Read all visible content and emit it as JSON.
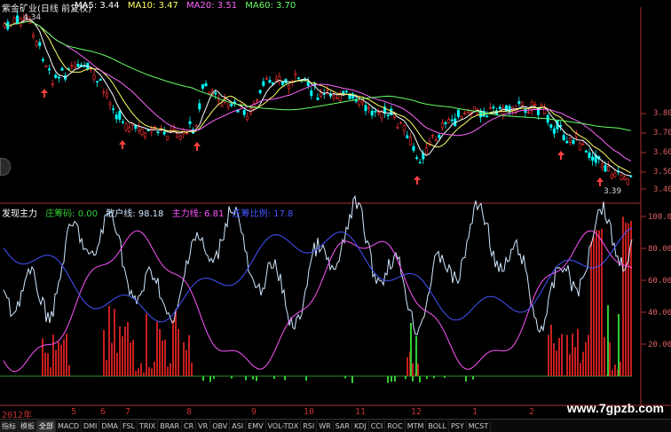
{
  "header": {
    "title": "紫金矿业(日线 前复权)",
    "ma": [
      {
        "label": "MA5: 3.44",
        "color": "#ffffff"
      },
      {
        "label": "MA10: 3.47",
        "color": "#ffff66"
      },
      {
        "label": "MA20: 3.51",
        "color": "#ff66ff"
      },
      {
        "label": "MA60: 3.70",
        "color": "#66ff66"
      }
    ],
    "high_mark": "4.34",
    "low_mark": "3.39"
  },
  "price_axis": [
    "3.80",
    "3.70",
    "3.60",
    "3.50",
    "3.40"
  ],
  "indicator": {
    "name": "发现主力",
    "fields": [
      {
        "label": "庄筹码: 0.00",
        "color": "#33cc33"
      },
      {
        "label": "散户线: 98.18",
        "color": "#cfe8ff"
      },
      {
        "label": "主力线: 6.81",
        "color": "#ff55ff"
      },
      {
        "label": "庄筹比例: 17.8",
        "color": "#4455ff"
      }
    ]
  },
  "indicator_axis": [
    "100.0",
    "80.00",
    "60.00",
    "40.00",
    "20.00"
  ],
  "time_axis": [
    "2012年",
    "5",
    "6",
    "7",
    "8",
    "9",
    "10",
    "11",
    "12",
    "1",
    "2"
  ],
  "tabs": [
    "指标",
    "模板",
    "全部",
    "MACD",
    "DMI",
    "DMA",
    "FSL",
    "TRIX",
    "BRAR",
    "CR",
    "VR",
    "OBV",
    "ASI",
    "EMV",
    "VOL-TDX",
    "RSI",
    "WR",
    "SAR",
    "KDJ",
    "CCI",
    "ROC",
    "MTM",
    "BOLL",
    "PSY",
    "MCST"
  ],
  "active_tab": "全部",
  "watermark": "www.7gpzb.com",
  "colors": {
    "up": "#ff3333",
    "down": "#00ffff",
    "ma5": "#ffffff",
    "ma10": "#ffff66",
    "ma20": "#ff66ff",
    "ma60": "#66ff66",
    "axis": "#b03030"
  }
}
